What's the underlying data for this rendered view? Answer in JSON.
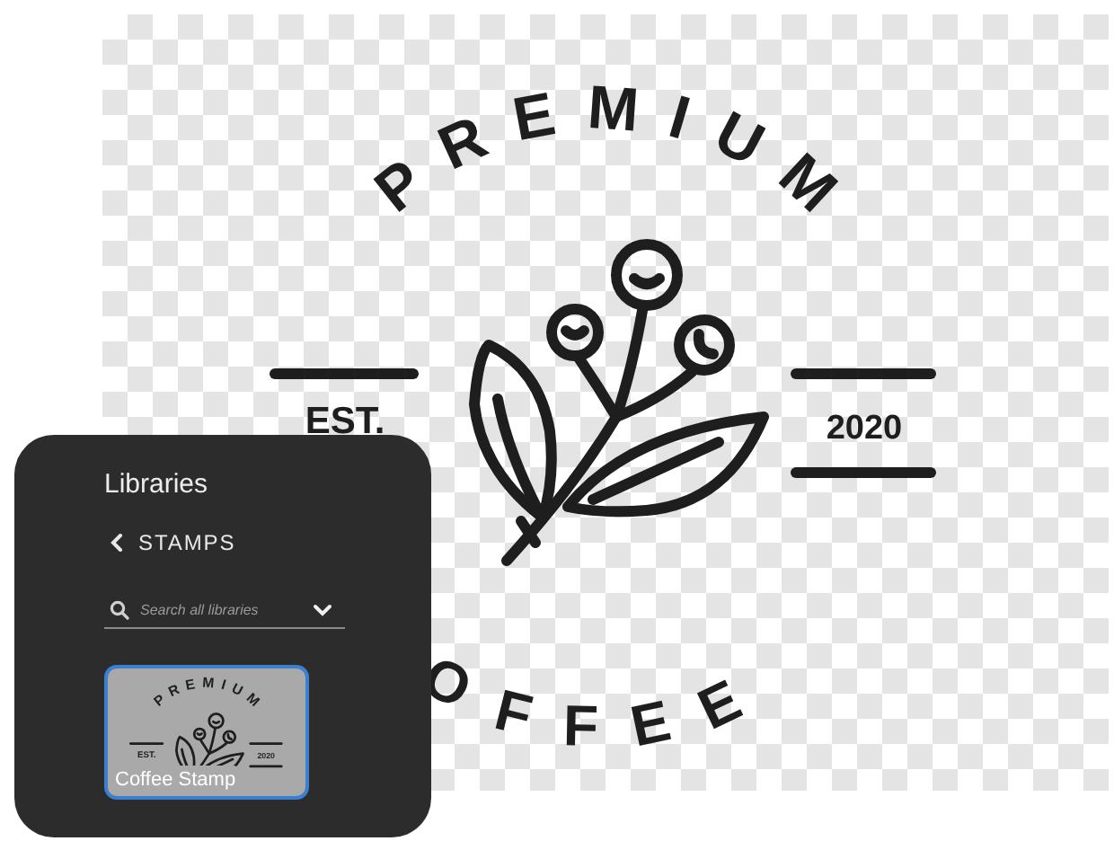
{
  "canvas": {
    "logo": {
      "top_text": "PREMIUM",
      "left_text": "EST.",
      "right_text": "2020",
      "bottom_text": "OFFEE"
    }
  },
  "libraries_panel": {
    "title": "Libraries",
    "breadcrumb": "STAMPS",
    "search": {
      "placeholder": "Search all libraries"
    },
    "items": [
      {
        "label": "Coffee Stamp",
        "selected": true,
        "stamp": {
          "top_text": "PREMIUM",
          "left_text": "EST.",
          "right_text": "2020"
        }
      }
    ]
  }
}
